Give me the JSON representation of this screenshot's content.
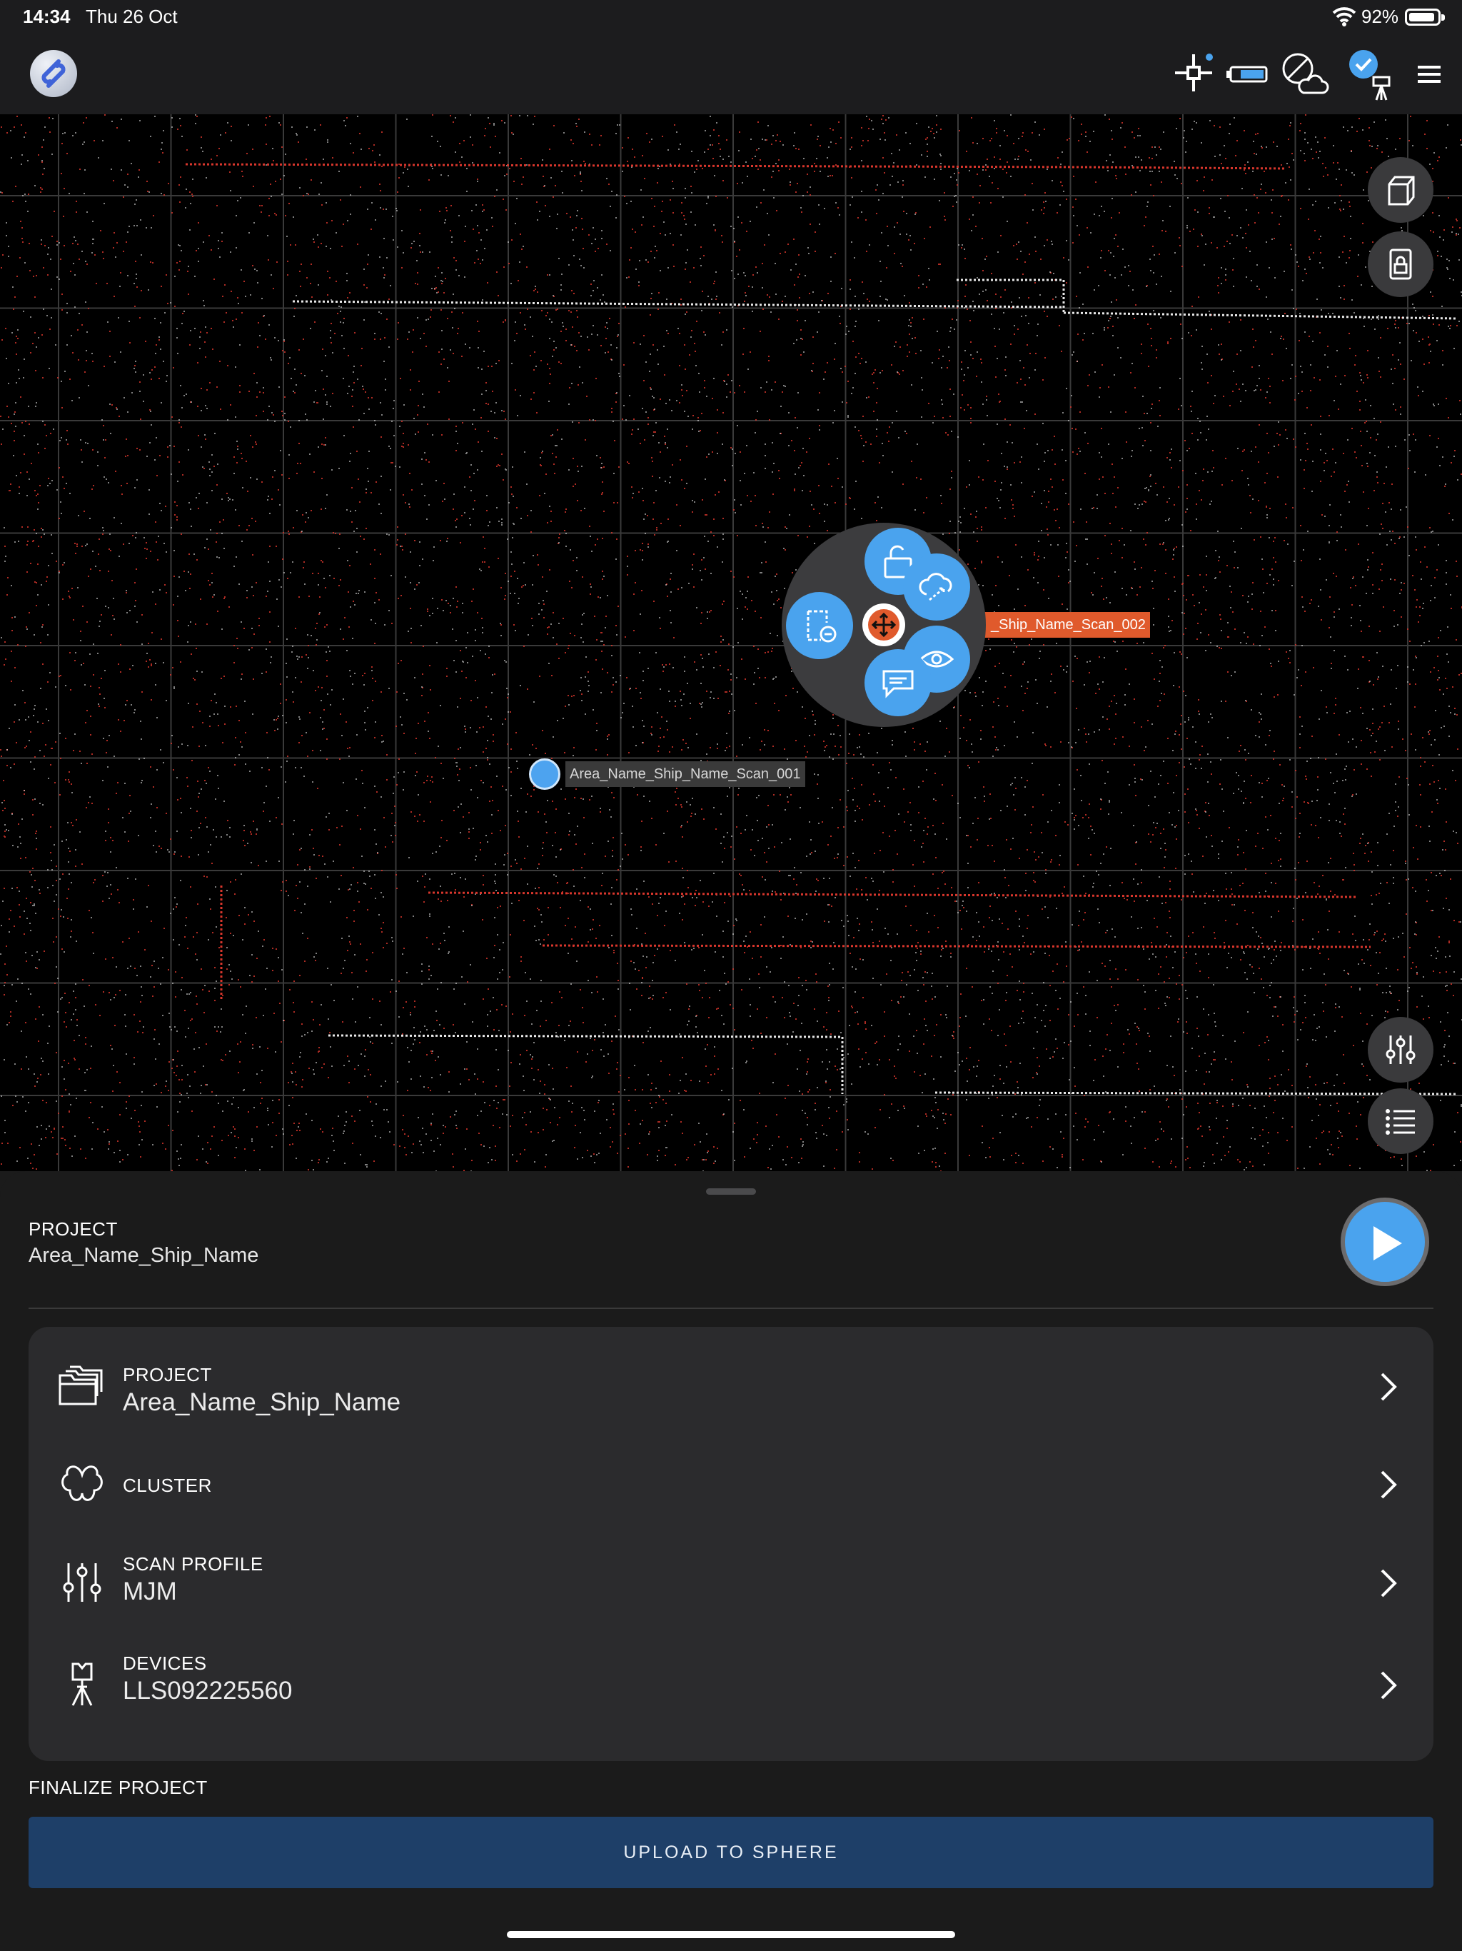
{
  "status_bar": {
    "time": "14:34",
    "date": "Thu 26 Oct",
    "battery_percent": "92%",
    "battery_level": 0.92
  },
  "top_bar": {
    "logo": "app-logo",
    "icons": [
      "crosshair-target-icon",
      "battery-device-icon",
      "cloud-disabled-icon",
      "scanner-connected-icon",
      "menu-icon"
    ]
  },
  "viewport": {
    "side_buttons_top": [
      "cube-3d-icon",
      "lock-icon"
    ],
    "side_buttons_bottom": [
      "sliders-icon",
      "list-icon"
    ],
    "scans": [
      {
        "label": "Area_Name_Ship_Name_Scan_001",
        "state": "inactive"
      },
      {
        "label": "_Ship_Name_Scan_002",
        "state": "active"
      }
    ],
    "radial_menu": [
      "unlock-icon",
      "cloud-registration-icon",
      "view-eye-icon",
      "comment-icon",
      "remove-frame-icon",
      "move-icon"
    ]
  },
  "sheet": {
    "project_caption": "PROJECT",
    "project_name": "Area_Name_Ship_Name",
    "rows": [
      {
        "caption": "PROJECT",
        "value": "Area_Name_Ship_Name",
        "icon": "folders-icon"
      },
      {
        "caption": "CLUSTER",
        "value": "",
        "icon": "cluster-icon"
      },
      {
        "caption": "SCAN PROFILE",
        "value": "MJM",
        "icon": "sliders-icon"
      },
      {
        "caption": "DEVICES",
        "value": "LLS092225560",
        "icon": "tripod-scanner-icon"
      }
    ],
    "finalize_caption": "FINALIZE PROJECT",
    "upload_label": "UPLOAD TO SPHERE"
  },
  "colors": {
    "accent": "#4aa3ee",
    "active_scan": "#e05a2c",
    "upload_button": "#1e3f68",
    "point_red": "#d8362c",
    "point_white": "#e8e8e8"
  }
}
